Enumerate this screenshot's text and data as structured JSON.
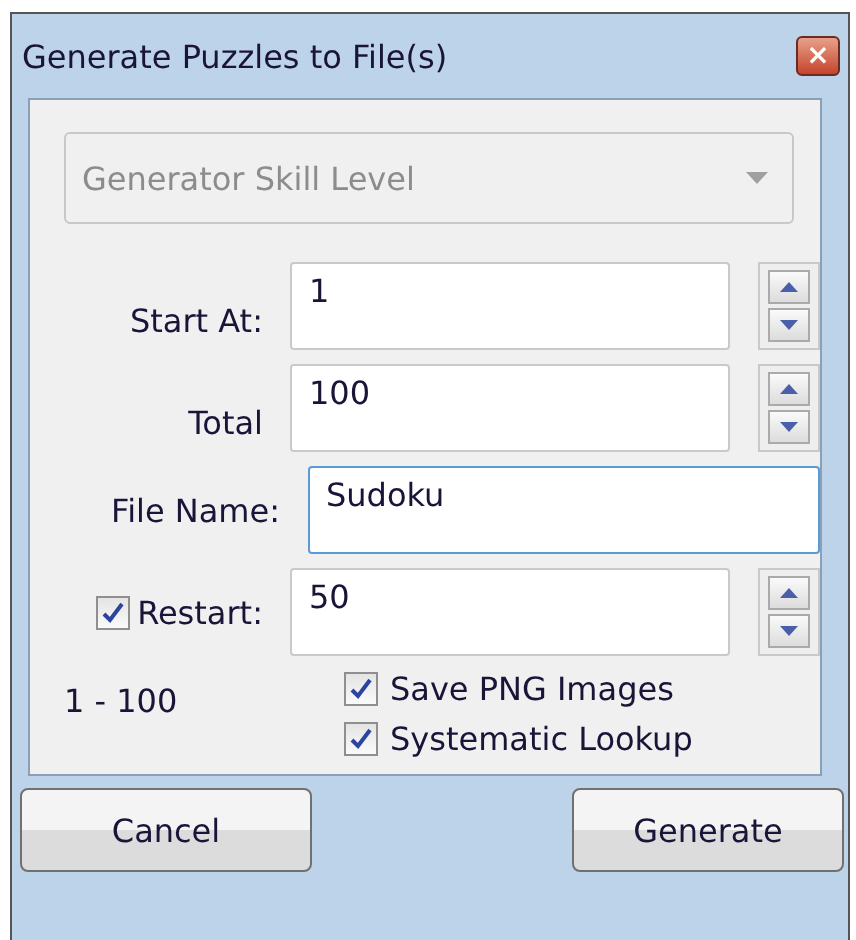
{
  "window": {
    "title": "Generate Puzzles to File(s)",
    "close": "×"
  },
  "skill_dropdown": {
    "placeholder": "Generator Skill Level",
    "disabled": true
  },
  "fields": [
    {
      "label": "Start At:",
      "value": "1",
      "kind": "spinner",
      "focused": false
    },
    {
      "label": "Total",
      "value": "100",
      "kind": "spinner",
      "focused": false
    },
    {
      "label": "File Name:",
      "value": "Sudoku",
      "kind": "text",
      "focused": true
    },
    {
      "label": "Restart:",
      "value": "50",
      "kind": "spinner",
      "focused": false,
      "checked": true
    }
  ],
  "range": "1 - 100",
  "options": [
    {
      "label": "Save PNG Images",
      "checked": true
    },
    {
      "label": "Systematic Lookup",
      "checked": true
    }
  ],
  "buttons": [
    "Cancel",
    "Generate"
  ]
}
